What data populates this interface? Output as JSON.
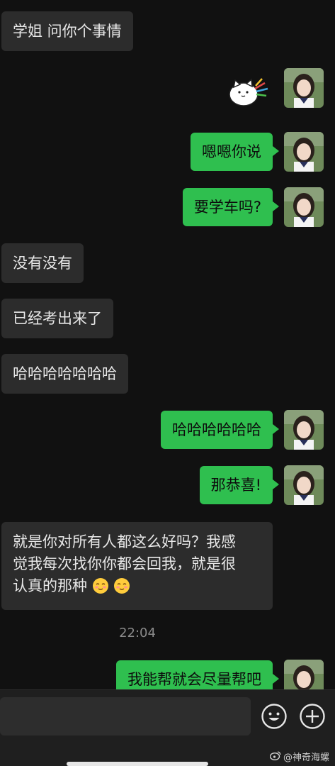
{
  "chat": {
    "messages": [
      {
        "dir": "in",
        "text": "学姐 问你个事情"
      },
      {
        "dir": "out",
        "type": "sticker",
        "sticker": "cat-sticker"
      },
      {
        "dir": "out",
        "text": "嗯嗯你说"
      },
      {
        "dir": "out",
        "text": "要学车吗?"
      },
      {
        "dir": "in",
        "text": "没有没有"
      },
      {
        "dir": "in",
        "text": "已经考出来了"
      },
      {
        "dir": "in",
        "text": "哈哈哈哈哈哈哈"
      },
      {
        "dir": "out",
        "text": "哈哈哈哈哈哈"
      },
      {
        "dir": "out",
        "text": "那恭喜!"
      },
      {
        "dir": "in",
        "text_line1": "就是你对所有人都这么好吗？我感",
        "text_line2": "觉我每次找你你都会回我，就是很",
        "text_line3": "认真的那种",
        "emoji": "smiling-blush-emoji"
      },
      {
        "dir": "out",
        "text": "我能帮就会尽量帮吧"
      }
    ],
    "timestamp": "22:04"
  },
  "input_bar": {
    "emoji_icon": "emoji-icon",
    "plus_icon": "plus-icon"
  },
  "watermark": {
    "text": "@神奇海螺",
    "icon": "weibo-icon"
  },
  "colors": {
    "background": "#111111",
    "incoming_bubble": "#2c2c2c",
    "outgoing_bubble": "#2fbf4f"
  }
}
